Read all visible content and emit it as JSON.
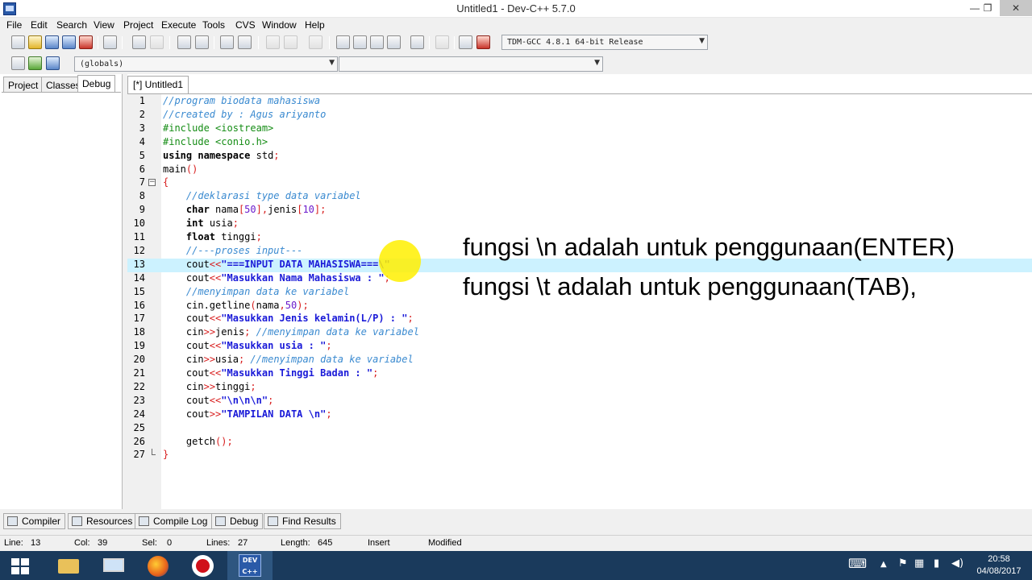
{
  "window": {
    "title": "Untitled1 - Dev-C++ 5.7.0",
    "minimize": "—",
    "restore": "❐",
    "close": "✕"
  },
  "menu": [
    "File",
    "Edit",
    "Search",
    "View",
    "Project",
    "Execute",
    "Tools",
    "CVS",
    "Window",
    "Help"
  ],
  "toolbar": {
    "compiler_select": "TDM-GCC 4.8.1 64-bit Release",
    "scope_select": "(globals)",
    "member_select": ""
  },
  "left_panel": {
    "tabs": [
      "Project",
      "Classes",
      "Debug"
    ],
    "active_tab": "Debug"
  },
  "editor": {
    "tab_label": "[*] Untitled1",
    "current_line": 13,
    "lines": [
      {
        "n": "1",
        "code": "//program biodata mahasiswa"
      },
      {
        "n": "2",
        "code": "//created by : Agus ariyanto"
      },
      {
        "n": "3",
        "code": "#include <iostream>"
      },
      {
        "n": "4",
        "code": "#include <conio.h>"
      },
      {
        "n": "5",
        "code": "using namespace std;"
      },
      {
        "n": "6",
        "code": "main()"
      },
      {
        "n": "7",
        "code": "{"
      },
      {
        "n": "8",
        "code": "    //deklarasi type data variabel"
      },
      {
        "n": "9",
        "code": "    char nama[50],jenis[10];"
      },
      {
        "n": "10",
        "code": "    int usia;"
      },
      {
        "n": "11",
        "code": "    float tinggi;"
      },
      {
        "n": "12",
        "code": "    //---proses input---"
      },
      {
        "n": "13",
        "code": "    cout<<\"===INPUT DATA MAHASISWA===\\\""
      },
      {
        "n": "14",
        "code": "    cout<<\"Masukkan Nama Mahasiswa : \";"
      },
      {
        "n": "15",
        "code": "    //menyimpan data ke variabel"
      },
      {
        "n": "16",
        "code": "    cin.getline(nama,50);"
      },
      {
        "n": "17",
        "code": "    cout<<\"Masukkan Jenis kelamin(L/P) : \";"
      },
      {
        "n": "18",
        "code": "    cin>>jenis; //menyimpan data ke variabel"
      },
      {
        "n": "19",
        "code": "    cout<<\"Masukkan usia : \";"
      },
      {
        "n": "20",
        "code": "    cin>>usia; //menyimpan data ke variabel"
      },
      {
        "n": "21",
        "code": "    cout<<\"Masukkan Tinggi Badan : \";"
      },
      {
        "n": "22",
        "code": "    cin>>tinggi;"
      },
      {
        "n": "23",
        "code": "    cout<<\"\\n\\n\\n\";"
      },
      {
        "n": "24",
        "code": "    cout>>\"TAMPILAN DATA \\n\";"
      },
      {
        "n": "25",
        "code": ""
      },
      {
        "n": "26",
        "code": "    getch();"
      },
      {
        "n": "27",
        "code": "}"
      }
    ]
  },
  "annotations": [
    "fungsi \\n adalah untuk penggunaan(ENTER)",
    "fungsi \\t adalah untuk penggunaan(TAB),"
  ],
  "bottom_tabs": [
    "Compiler",
    "Resources",
    "Compile Log",
    "Debug",
    "Find Results"
  ],
  "status": {
    "line_label": "Line:",
    "line": "13",
    "col_label": "Col:",
    "col": "39",
    "sel_label": "Sel:",
    "sel": "0",
    "lines_label": "Lines:",
    "lines": "27",
    "length_label": "Length:",
    "length": "645",
    "mode": "Insert",
    "state": "Modified"
  },
  "taskbar": {
    "time": "20:58",
    "date": "04/08/2017",
    "tray_expand": "▲"
  },
  "colors": {
    "current_line": "#ccf2ff",
    "comment": "#3a8ad0",
    "string": "#1a1ad8",
    "preprocessor": "#148c14",
    "symbol": "#d81e1e",
    "taskbar": "#1a3a5c",
    "cursor_highlight": "#fff000"
  }
}
